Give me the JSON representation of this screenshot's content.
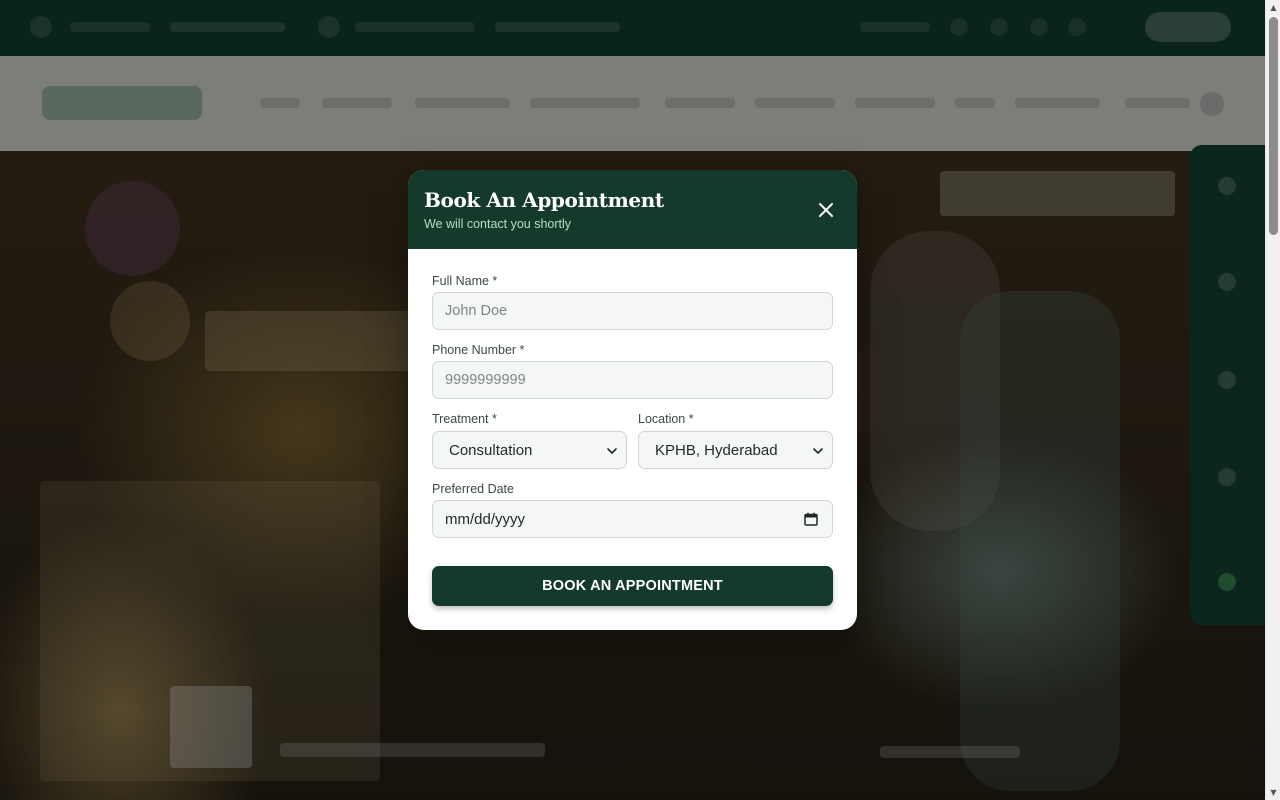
{
  "modal": {
    "title": "Book An Appointment",
    "subtitle": "We will contact you shortly",
    "close_icon": "close-icon",
    "full_name": {
      "label": "Full Name *",
      "placeholder": "John Doe",
      "value": ""
    },
    "phone": {
      "label": "Phone Number *",
      "placeholder": "9999999999",
      "value": ""
    },
    "treatment": {
      "label": "Treatment *",
      "selected": "Consultation"
    },
    "location": {
      "label": "Location *",
      "selected": "KPHB, Hyderabad"
    },
    "preferred_date": {
      "label": "Preferred Date",
      "value": "mm/dd/yyyy",
      "icon": "calendar-icon"
    },
    "submit_label": "BOOK AN APPOINTMENT"
  },
  "colors": {
    "header_bg": "#143a2c",
    "accent_green": "#0f3a2a",
    "button_bg": "#143a2c",
    "subtitle": "#b9dcc4"
  }
}
